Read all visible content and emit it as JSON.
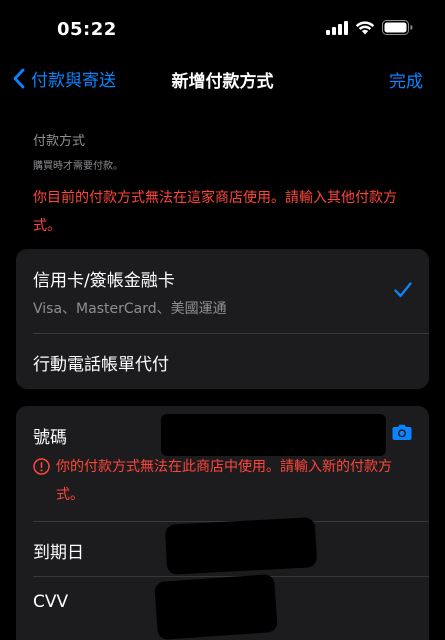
{
  "status_bar": {
    "time": "05:22"
  },
  "nav": {
    "back_label": "付款與寄送",
    "title": "新增付款方式",
    "done_label": "完成"
  },
  "section": {
    "title": "付款方式",
    "subtitle": "購買時才需要付款。",
    "error": "你目前的付款方式無法在這家商店使用。請輸入其他付款方式。"
  },
  "payment_methods": [
    {
      "label": "信用卡/簽帳金融卡",
      "sublabel": "Visa、MasterCard、美國運通",
      "selected": true
    },
    {
      "label": "行動電話帳單代付",
      "selected": false
    }
  ],
  "card_fields": {
    "number_label": "號碼",
    "number_error": "你的付款方式無法在此商店中使用。請輸入新的付款方式。",
    "expiry_label": "到期日",
    "cvv_label": "CVV"
  },
  "colors": {
    "accent": "#0a84ff",
    "error": "#ff453a",
    "card_bg": "#1c1c1e"
  },
  "icons": {
    "back": "chevron-left-icon",
    "check": "checkmark-icon",
    "camera": "camera-icon",
    "error": "exclamation-circle-icon"
  }
}
